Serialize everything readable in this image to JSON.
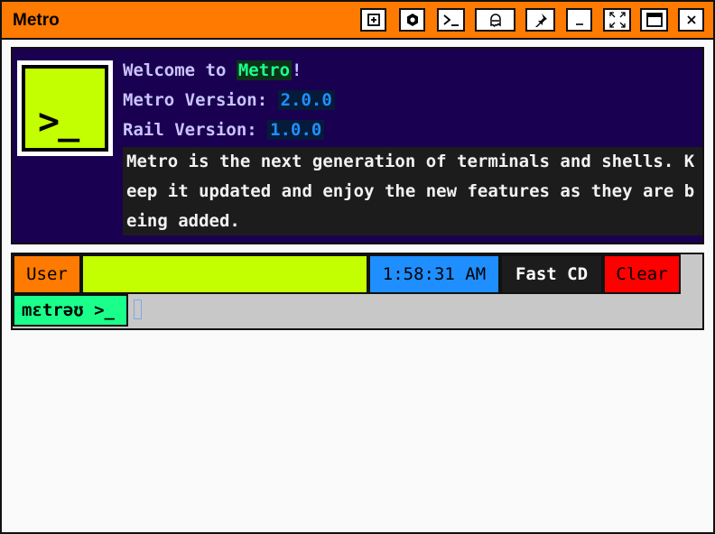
{
  "window": {
    "title": "Metro",
    "buttons": [
      {
        "name": "new-tab-icon"
      },
      {
        "name": "settings-icon"
      },
      {
        "name": "terminal-icon"
      },
      {
        "name": "ghost-icon"
      },
      {
        "name": "pin-icon"
      },
      {
        "name": "minimize-icon"
      },
      {
        "name": "fullscreen-icon"
      },
      {
        "name": "maximize-icon"
      },
      {
        "name": "close-icon"
      }
    ]
  },
  "banner": {
    "logo_text": ">_",
    "welcome_prefix": "Welcome to ",
    "welcome_name": "Metro",
    "welcome_suffix": "!",
    "metro_version_label": "Metro Version: ",
    "metro_version": "2.0.0",
    "rail_version_label": "Rail Version: ",
    "rail_version": "1.0.0",
    "description": "Metro is the next generation of terminals and shells. Keep it updated and enjoy the new features as they are being added."
  },
  "statusbar": {
    "user_label": "User",
    "user_value": "",
    "clock": "1:58:31 AM",
    "fast_cd": "Fast CD",
    "clear": "Clear"
  },
  "prompt": {
    "text": "mɛtrəʊ >_",
    "input_value": ""
  },
  "colors": {
    "titlebar": "#ff7a00",
    "banner_bg": "#1a0050",
    "accent_lime": "#c3ff00",
    "accent_green": "#1aff8a",
    "accent_blue": "#1f8fff",
    "clear_red": "#ff0000"
  }
}
